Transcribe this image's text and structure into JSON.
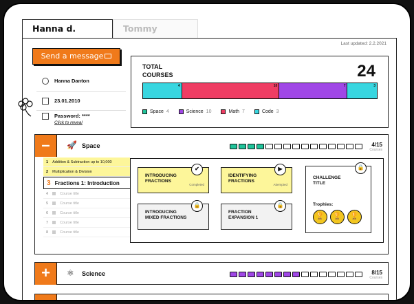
{
  "tabs": [
    {
      "label": "Hanna d."
    },
    {
      "label": "Tommy"
    }
  ],
  "last_updated": "Last updated: 2.2.2021",
  "send_message_label": "Send a message",
  "profile": {
    "name": "Hanna Danton",
    "birthdate": "23.01.2010",
    "password_label": "Password: ****",
    "reveal_label": "Click to reveal"
  },
  "total": {
    "title": "TOTAL COURSES",
    "count": "24",
    "segments": [
      {
        "name": "Space",
        "value": 4,
        "label": "4",
        "color": "#38d6e0"
      },
      {
        "name": "Math",
        "value": 10,
        "label": "10",
        "color": "#ef3d63"
      },
      {
        "name": "Science",
        "value": 7,
        "label": "7",
        "color": "#a047e6"
      },
      {
        "name": "Code",
        "value": 3,
        "label": "3",
        "color": "#38d6e0"
      }
    ],
    "legend": [
      {
        "name": "Space",
        "count": "4",
        "color": "#20c39a"
      },
      {
        "name": "Science",
        "count": "10",
        "color": "#a047e6"
      },
      {
        "name": "Math",
        "count": "7",
        "color": "#ef3d63"
      },
      {
        "name": "Code",
        "count": "3",
        "color": "#38d6e0"
      }
    ]
  },
  "space": {
    "toggle": "–",
    "title": "Space",
    "progress_text": "4/15",
    "progress_label": "Courses",
    "filled": 4,
    "total": 15,
    "fill_color": "#20c39a",
    "sidebar": [
      {
        "num": "1",
        "label": "Addition & Subtraction up to 10,000",
        "state": "done"
      },
      {
        "num": "2",
        "label": "Multiplication & Division",
        "state": "done"
      },
      {
        "num": "3",
        "label": "Fractions 1: Introduction",
        "state": "active"
      },
      {
        "num": "4",
        "label": "Course title",
        "state": "locked"
      },
      {
        "num": "5",
        "label": "Course title",
        "state": "locked"
      },
      {
        "num": "6",
        "label": "Course title",
        "state": "locked"
      },
      {
        "num": "7",
        "label": "Course title",
        "state": "locked"
      },
      {
        "num": "8",
        "label": "Course title",
        "state": "locked"
      }
    ],
    "cards": {
      "intro_line1": "INTRODUCING",
      "intro_line2": "FRACTIONS",
      "intro_status": "Completed",
      "ident_line1": "IDENTIFYING",
      "ident_line2": "FRACTIONS",
      "ident_status": "Attempted",
      "mixed_line1": "INTRODUCING",
      "mixed_line2": "MIXED FRACTIONS",
      "exp_line1": "FRACTION",
      "exp_line2": "EXPANSION 1",
      "challenge_line1": "CHALLENGE",
      "challenge_line2": "TITLE",
      "trophies_label": "Trophies:"
    }
  },
  "science": {
    "toggle": "+",
    "title": "Science",
    "progress_text": "8/15",
    "progress_label": "Courses",
    "filled": 8,
    "total": 15,
    "fill_color": "#a047e6"
  },
  "third": {
    "toggle": "+"
  }
}
